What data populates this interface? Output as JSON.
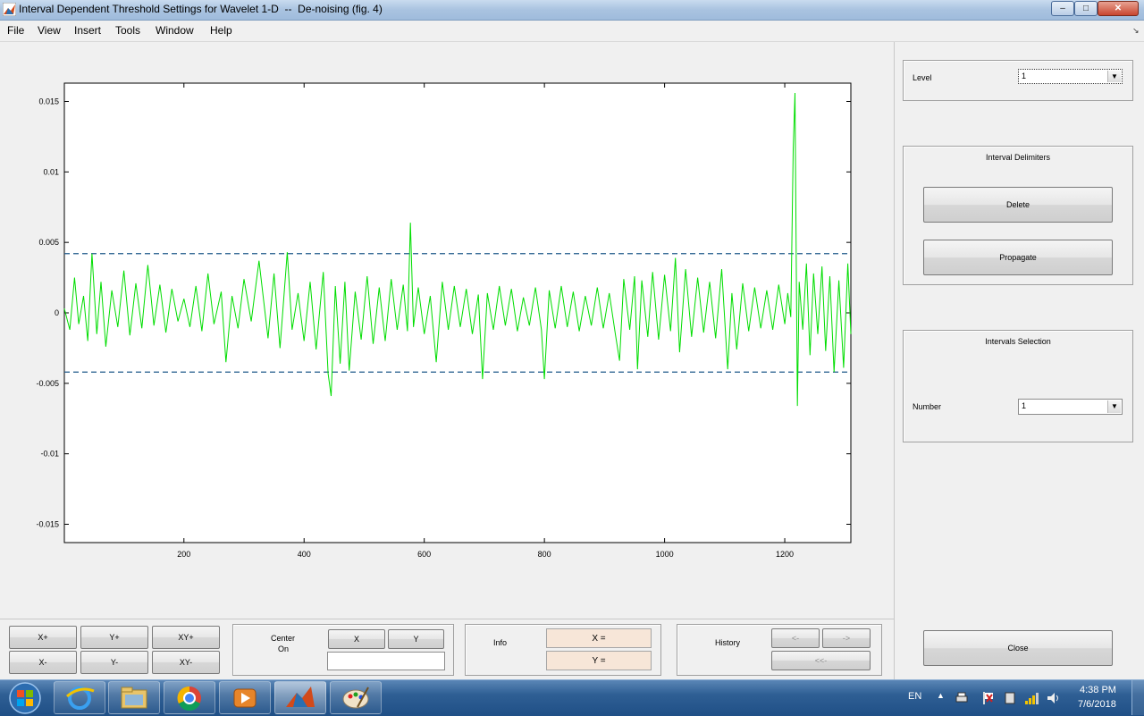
{
  "window": {
    "title": "Interval Dependent Threshold Settings for Wavelet 1-D  --  De-noising (fig. 4)",
    "controls": {
      "minimize": "–",
      "maximize": "□",
      "close": "✕"
    }
  },
  "menu": [
    "File",
    "View",
    "Insert",
    "Tools",
    "Window",
    "Help"
  ],
  "menu_corner_icon": "dock-arrow-icon",
  "chart_data": {
    "type": "line",
    "x_ticks": [
      200,
      400,
      600,
      800,
      1000,
      1200
    ],
    "y_ticks": [
      0.015,
      0.01,
      0.005,
      0,
      -0.005,
      -0.01,
      -0.015
    ],
    "y_tick_labels": [
      "0.015",
      "0.01",
      "0.005",
      "0",
      "-0.005",
      "-0.01",
      "-0.015"
    ],
    "x_tick_labels": [
      "200",
      "400",
      "600",
      "800",
      "1000",
      "1200"
    ],
    "xlim": [
      1,
      1310
    ],
    "ylim": [
      -0.0163,
      0.0163
    ],
    "grid": false,
    "series": [
      {
        "color": "#00dd00",
        "points": [
          [
            1,
            0.0003
          ],
          [
            10,
            -0.0012
          ],
          [
            18,
            0.0025
          ],
          [
            25,
            -0.0008
          ],
          [
            33,
            0.0012
          ],
          [
            40,
            -0.002
          ],
          [
            47,
            0.0042
          ],
          [
            55,
            -0.0015
          ],
          [
            62,
            0.0022
          ],
          [
            70,
            -0.0024
          ],
          [
            80,
            0.0016
          ],
          [
            90,
            -0.001
          ],
          [
            100,
            0.003
          ],
          [
            110,
            -0.0016
          ],
          [
            120,
            0.0021
          ],
          [
            130,
            -0.0011
          ],
          [
            140,
            0.0034
          ],
          [
            150,
            -0.0009
          ],
          [
            160,
            0.002
          ],
          [
            170,
            -0.0014
          ],
          [
            180,
            0.0017
          ],
          [
            190,
            -0.0006
          ],
          [
            200,
            0.001
          ],
          [
            210,
            -0.001
          ],
          [
            220,
            0.0019
          ],
          [
            230,
            -0.0013
          ],
          [
            240,
            0.0028
          ],
          [
            250,
            -0.0008
          ],
          [
            262,
            0.0015
          ],
          [
            270,
            -0.0035
          ],
          [
            280,
            0.0012
          ],
          [
            290,
            -0.0011
          ],
          [
            300,
            0.0024
          ],
          [
            312,
            -0.0006
          ],
          [
            325,
            0.0037
          ],
          [
            340,
            -0.0018
          ],
          [
            350,
            0.0028
          ],
          [
            360,
            -0.0025
          ],
          [
            372,
            0.0043
          ],
          [
            380,
            -0.0012
          ],
          [
            390,
            0.0014
          ],
          [
            400,
            -0.002
          ],
          [
            410,
            0.0022
          ],
          [
            420,
            -0.0026
          ],
          [
            432,
            0.0029
          ],
          [
            440,
            -0.0043
          ],
          [
            445,
            -0.0059
          ],
          [
            452,
            0.0019
          ],
          [
            460,
            -0.0036
          ],
          [
            468,
            0.0022
          ],
          [
            475,
            -0.0041
          ],
          [
            485,
            0.0015
          ],
          [
            495,
            -0.0019
          ],
          [
            505,
            0.0026
          ],
          [
            515,
            -0.0022
          ],
          [
            525,
            0.0018
          ],
          [
            535,
            -0.002
          ],
          [
            545,
            0.0024
          ],
          [
            555,
            -0.0012
          ],
          [
            565,
            0.002
          ],
          [
            572,
            -0.0013
          ],
          [
            577,
            0.0064
          ],
          [
            582,
            -0.001
          ],
          [
            590,
            0.0018
          ],
          [
            600,
            -0.0015
          ],
          [
            610,
            0.0012
          ],
          [
            620,
            -0.0035
          ],
          [
            630,
            0.0022
          ],
          [
            640,
            -0.0012
          ],
          [
            650,
            0.0019
          ],
          [
            660,
            -0.001
          ],
          [
            670,
            0.0017
          ],
          [
            680,
            -0.0015
          ],
          [
            690,
            0.0013
          ],
          [
            697,
            -0.0047
          ],
          [
            705,
            0.0014
          ],
          [
            715,
            -0.0012
          ],
          [
            725,
            0.0019
          ],
          [
            735,
            -0.0009
          ],
          [
            745,
            0.0017
          ],
          [
            755,
            -0.0013
          ],
          [
            765,
            0.0011
          ],
          [
            775,
            -0.0009
          ],
          [
            785,
            0.0018
          ],
          [
            795,
            -0.0012
          ],
          [
            800,
            -0.0047
          ],
          [
            808,
            0.0016
          ],
          [
            818,
            -0.0011
          ],
          [
            828,
            0.0019
          ],
          [
            838,
            -0.001
          ],
          [
            848,
            0.0015
          ],
          [
            858,
            -0.0013
          ],
          [
            868,
            0.0012
          ],
          [
            878,
            -0.0009
          ],
          [
            888,
            0.0018
          ],
          [
            898,
            -0.0011
          ],
          [
            908,
            0.0014
          ],
          [
            918,
            -0.0015
          ],
          [
            925,
            -0.0034
          ],
          [
            932,
            0.0024
          ],
          [
            942,
            -0.0012
          ],
          [
            950,
            0.0026
          ],
          [
            955,
            -0.004
          ],
          [
            962,
            0.0023
          ],
          [
            972,
            -0.0017
          ],
          [
            980,
            0.0029
          ],
          [
            990,
            -0.0019
          ],
          [
            1000,
            0.0027
          ],
          [
            1010,
            -0.0013
          ],
          [
            1018,
            0.0039
          ],
          [
            1025,
            -0.0028
          ],
          [
            1035,
            0.0031
          ],
          [
            1045,
            -0.0017
          ],
          [
            1055,
            0.0025
          ],
          [
            1065,
            -0.0014
          ],
          [
            1075,
            0.0022
          ],
          [
            1085,
            -0.0018
          ],
          [
            1095,
            0.0031
          ],
          [
            1105,
            -0.004
          ],
          [
            1112,
            0.0014
          ],
          [
            1120,
            -0.0026
          ],
          [
            1130,
            0.0021
          ],
          [
            1140,
            -0.0013
          ],
          [
            1150,
            0.0018
          ],
          [
            1160,
            -0.0011
          ],
          [
            1170,
            0.0016
          ],
          [
            1180,
            -0.0012
          ],
          [
            1190,
            0.002
          ],
          [
            1200,
            -0.0008
          ],
          [
            1205,
            0.0014
          ],
          [
            1210,
            -0.0003
          ],
          [
            1214,
            0.0116
          ],
          [
            1217,
            0.0156
          ],
          [
            1219,
            0.0045
          ],
          [
            1221,
            -0.0066
          ],
          [
            1224,
            0.0022
          ],
          [
            1230,
            -0.0012
          ],
          [
            1236,
            0.0035
          ],
          [
            1242,
            -0.003
          ],
          [
            1248,
            0.0028
          ],
          [
            1255,
            -0.0015
          ],
          [
            1262,
            0.0033
          ],
          [
            1268,
            -0.0027
          ],
          [
            1275,
            0.0026
          ],
          [
            1282,
            -0.0042
          ],
          [
            1290,
            0.0023
          ],
          [
            1298,
            -0.0039
          ],
          [
            1305,
            0.0035
          ],
          [
            1310,
            -0.0015
          ]
        ]
      }
    ],
    "thresholds": [
      {
        "value": 0.0042,
        "color": "#1f5a8a",
        "style": "dashed"
      },
      {
        "value": -0.0042,
        "color": "#1f5a8a",
        "style": "dashed"
      }
    ]
  },
  "right_panel": {
    "level": {
      "label": "Level",
      "value": "1"
    },
    "interval_delimiters": {
      "title": "Interval Delimiters",
      "delete_label": "Delete",
      "propagate_label": "Propagate"
    },
    "intervals_selection": {
      "title": "Intervals Selection",
      "number_label": "Number",
      "number_value": "1"
    },
    "close_label": "Close"
  },
  "bottom_toolbar": {
    "zoom": {
      "x_plus": "X+",
      "y_plus": "Y+",
      "xy_plus": "XY+",
      "x_minus": "X-",
      "y_minus": "Y-",
      "xy_minus": "XY-"
    },
    "center_on": {
      "label_line1": "Center",
      "label_line2": "On",
      "x_button": "X",
      "y_button": "Y",
      "value": ""
    },
    "info": {
      "label": "Info",
      "x_field": "X =",
      "y_field": "Y ="
    },
    "history": {
      "label": "History",
      "back": "<-",
      "forward": "->",
      "first": "<<-"
    }
  },
  "taskbar": {
    "apps": [
      {
        "name": "internet-explorer-icon"
      },
      {
        "name": "file-explorer-icon"
      },
      {
        "name": "chrome-icon"
      },
      {
        "name": "media-player-icon"
      },
      {
        "name": "matlab-icon",
        "active": true
      },
      {
        "name": "paint-icon"
      }
    ],
    "tray": {
      "lang": "EN",
      "time": "4:38 PM",
      "date": "7/6/2018"
    },
    "colors": {
      "accent": "#1f4f86"
    }
  }
}
